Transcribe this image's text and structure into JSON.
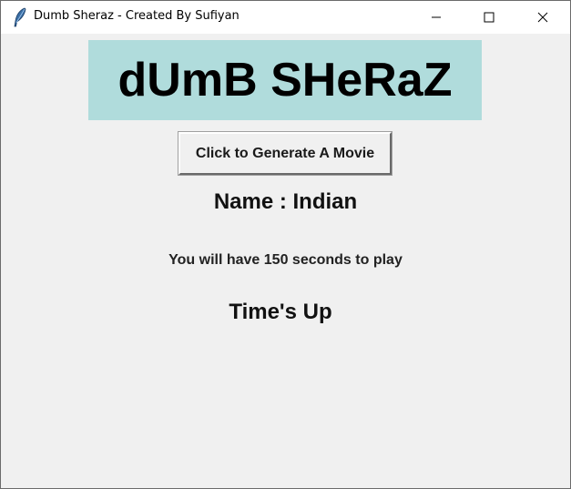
{
  "window": {
    "title": "Dumb Sheraz - Created By Sufiyan",
    "icon": "feather-icon",
    "controls": [
      "minimize-icon",
      "maximize-icon",
      "close-icon"
    ]
  },
  "app": {
    "banner_text": "dUmB SHeRaZ",
    "banner_color": "#b0dcdc",
    "generate_button_label": "Click to Generate A Movie",
    "name_label": "Name : Indian",
    "info_label": "You will have 150 seconds to play",
    "timer_label": "Time's Up"
  }
}
